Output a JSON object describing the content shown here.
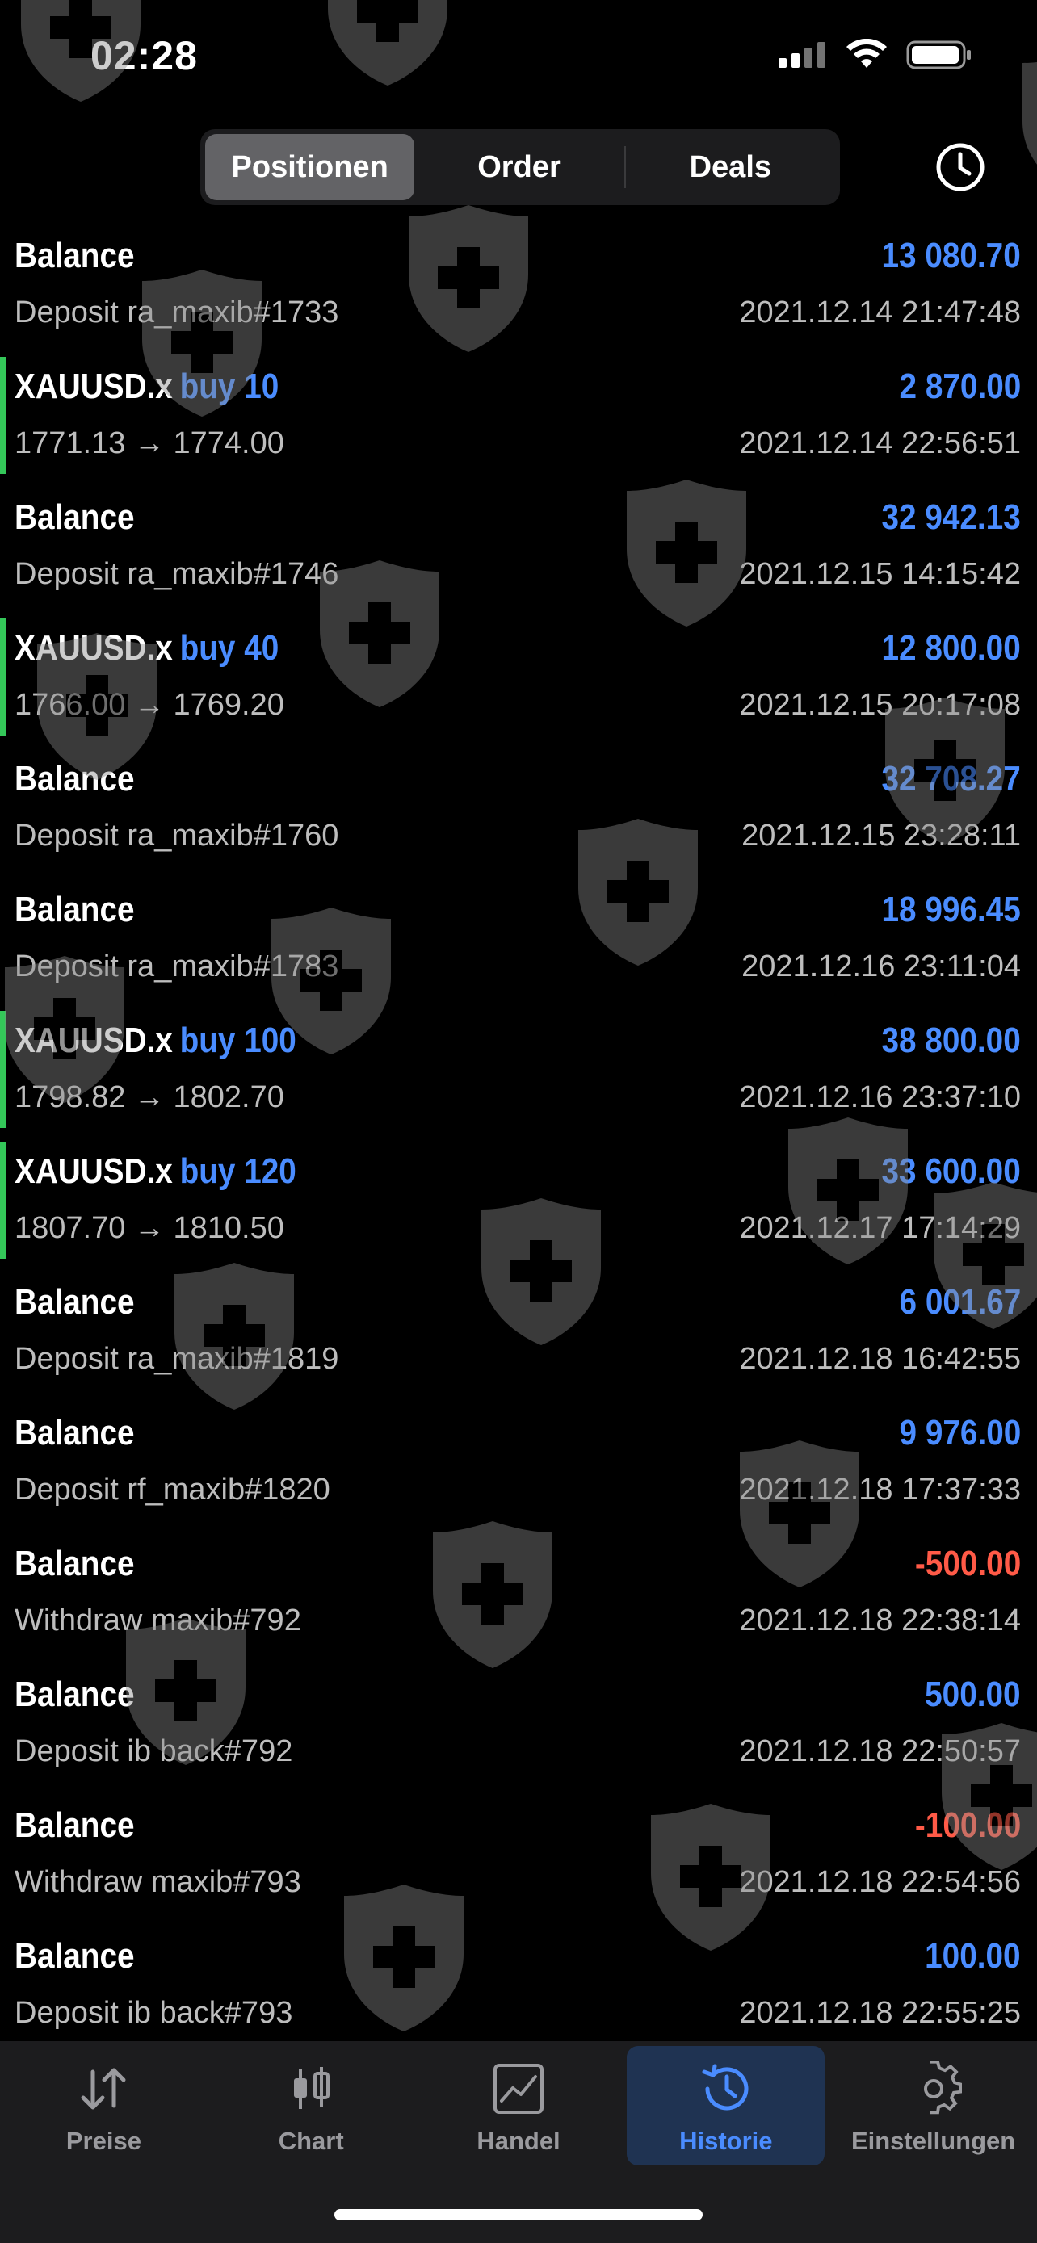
{
  "status_bar": {
    "time": "02:28"
  },
  "header": {
    "segments": [
      "Positionen",
      "Order",
      "Deals"
    ],
    "active_segment": "Positionen"
  },
  "rows": [
    {
      "title": "Balance",
      "action": "",
      "sub": "Deposit ra_maxib#1733",
      "amount": "13 080.70",
      "time": "2021.12.14 21:47:48",
      "negative": false,
      "marker": false
    },
    {
      "title": "XAUUSD.x",
      "action": "buy 10",
      "sub": "1771.13 → 1774.00",
      "amount": "2 870.00",
      "time": "2021.12.14 22:56:51",
      "negative": false,
      "marker": true
    },
    {
      "title": "Balance",
      "action": "",
      "sub": "Deposit ra_maxib#1746",
      "amount": "32 942.13",
      "time": "2021.12.15 14:15:42",
      "negative": false,
      "marker": false
    },
    {
      "title": "XAUUSD.x",
      "action": "buy 40",
      "sub": "1766.00 → 1769.20",
      "amount": "12 800.00",
      "time": "2021.12.15 20:17:08",
      "negative": false,
      "marker": true
    },
    {
      "title": "Balance",
      "action": "",
      "sub": "Deposit ra_maxib#1760",
      "amount": "32 708.27",
      "time": "2021.12.15 23:28:11",
      "negative": false,
      "marker": false
    },
    {
      "title": "Balance",
      "action": "",
      "sub": "Deposit ra_maxib#1783",
      "amount": "18 996.45",
      "time": "2021.12.16 23:11:04",
      "negative": false,
      "marker": false
    },
    {
      "title": "XAUUSD.x",
      "action": "buy 100",
      "sub": "1798.82 → 1802.70",
      "amount": "38 800.00",
      "time": "2021.12.16 23:37:10",
      "negative": false,
      "marker": true
    },
    {
      "title": "XAUUSD.x",
      "action": "buy 120",
      "sub": "1807.70 → 1810.50",
      "amount": "33 600.00",
      "time": "2021.12.17 17:14:29",
      "negative": false,
      "marker": true
    },
    {
      "title": "Balance",
      "action": "",
      "sub": "Deposit ra_maxib#1819",
      "amount": "6 001.67",
      "time": "2021.12.18 16:42:55",
      "negative": false,
      "marker": false
    },
    {
      "title": "Balance",
      "action": "",
      "sub": "Deposit rf_maxib#1820",
      "amount": "9 976.00",
      "time": "2021.12.18 17:37:33",
      "negative": false,
      "marker": false
    },
    {
      "title": "Balance",
      "action": "",
      "sub": "Withdraw maxib#792",
      "amount": "-500.00",
      "time": "2021.12.18 22:38:14",
      "negative": true,
      "marker": false
    },
    {
      "title": "Balance",
      "action": "",
      "sub": "Deposit ib back#792",
      "amount": "500.00",
      "time": "2021.12.18 22:50:57",
      "negative": false,
      "marker": false
    },
    {
      "title": "Balance",
      "action": "",
      "sub": "Withdraw maxib#793",
      "amount": "-100.00",
      "time": "2021.12.18 22:54:56",
      "negative": true,
      "marker": false
    },
    {
      "title": "Balance",
      "action": "",
      "sub": "Deposit ib back#793",
      "amount": "100.00",
      "time": "2021.12.18 22:55:25",
      "negative": false,
      "marker": false
    }
  ],
  "tabbar": {
    "tabs": [
      {
        "label": "Preise",
        "icon": "arrows-up-down-icon"
      },
      {
        "label": "Chart",
        "icon": "candlestick-icon"
      },
      {
        "label": "Handel",
        "icon": "trade-chart-icon"
      },
      {
        "label": "Historie",
        "icon": "history-icon"
      },
      {
        "label": "Einstellungen",
        "icon": "gear-icon"
      }
    ],
    "active_tab": "Historie"
  },
  "colors": {
    "positive": "#4a8cff",
    "negative": "#ff5a47",
    "marker": "#34c759",
    "background": "#000000"
  }
}
